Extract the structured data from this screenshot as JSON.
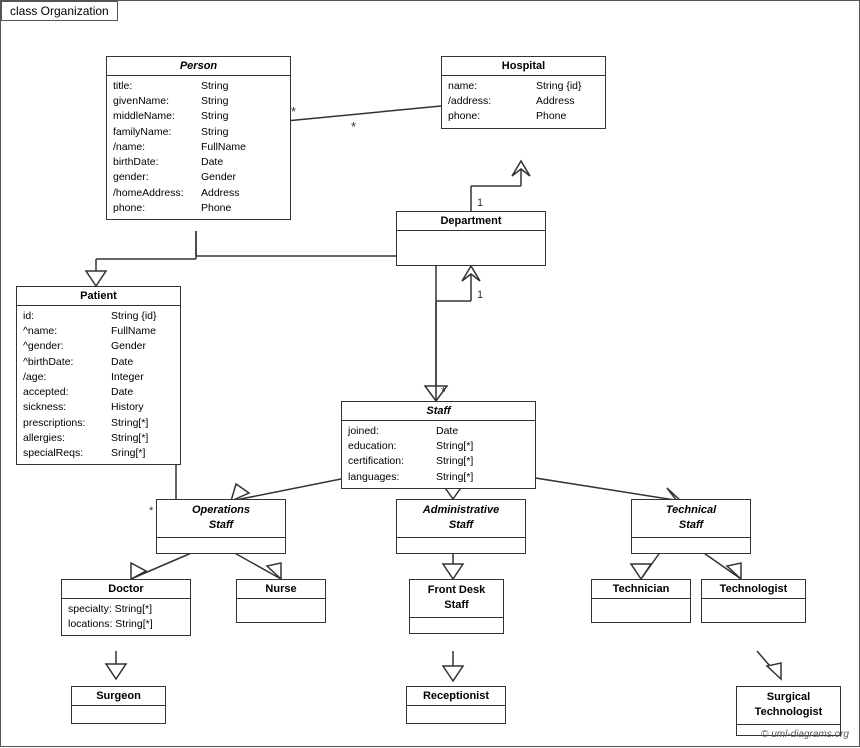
{
  "diagram": {
    "title": "class Organization",
    "classes": {
      "person": {
        "name": "Person",
        "italic": true,
        "attrs": [
          {
            "name": "title:",
            "type": "String"
          },
          {
            "name": "givenName:",
            "type": "String"
          },
          {
            "name": "middleName:",
            "type": "String"
          },
          {
            "name": "familyName:",
            "type": "String"
          },
          {
            "name": "/name:",
            "type": "FullName"
          },
          {
            "name": "birthDate:",
            "type": "Date"
          },
          {
            "name": "gender:",
            "type": "Gender"
          },
          {
            "name": "/homeAddress:",
            "type": "Address"
          },
          {
            "name": "phone:",
            "type": "Phone"
          }
        ]
      },
      "hospital": {
        "name": "Hospital",
        "italic": false,
        "attrs": [
          {
            "name": "name:",
            "type": "String {id}"
          },
          {
            "name": "/address:",
            "type": "Address"
          },
          {
            "name": "phone:",
            "type": "Phone"
          }
        ]
      },
      "patient": {
        "name": "Patient",
        "italic": false,
        "attrs": [
          {
            "name": "id:",
            "type": "String {id}"
          },
          {
            "name": "^name:",
            "type": "FullName"
          },
          {
            "name": "^gender:",
            "type": "Gender"
          },
          {
            "name": "^birthDate:",
            "type": "Date"
          },
          {
            "name": "/age:",
            "type": "Integer"
          },
          {
            "name": "accepted:",
            "type": "Date"
          },
          {
            "name": "sickness:",
            "type": "History"
          },
          {
            "name": "prescriptions:",
            "type": "String[*]"
          },
          {
            "name": "allergies:",
            "type": "String[*]"
          },
          {
            "name": "specialReqs:",
            "type": "Sring[*]"
          }
        ]
      },
      "department": {
        "name": "Department",
        "italic": false,
        "attrs": []
      },
      "staff": {
        "name": "Staff",
        "italic": true,
        "attrs": [
          {
            "name": "joined:",
            "type": "Date"
          },
          {
            "name": "education:",
            "type": "String[*]"
          },
          {
            "name": "certification:",
            "type": "String[*]"
          },
          {
            "name": "languages:",
            "type": "String[*]"
          }
        ]
      },
      "operations_staff": {
        "name": "Operations\nStaff",
        "italic": true,
        "attrs": []
      },
      "administrative_staff": {
        "name": "Administrative\nStaff",
        "italic": true,
        "attrs": []
      },
      "technical_staff": {
        "name": "Technical\nStaff",
        "italic": true,
        "attrs": []
      },
      "doctor": {
        "name": "Doctor",
        "italic": false,
        "attrs": [
          {
            "name": "specialty:",
            "type": "String[*]"
          },
          {
            "name": "locations:",
            "type": "String[*]"
          }
        ]
      },
      "nurse": {
        "name": "Nurse",
        "italic": false,
        "attrs": []
      },
      "front_desk_staff": {
        "name": "Front Desk\nStaff",
        "italic": false,
        "attrs": []
      },
      "technician": {
        "name": "Technician",
        "italic": false,
        "attrs": []
      },
      "technologist": {
        "name": "Technologist",
        "italic": false,
        "attrs": []
      },
      "surgeon": {
        "name": "Surgeon",
        "italic": false,
        "attrs": []
      },
      "receptionist": {
        "name": "Receptionist",
        "italic": false,
        "attrs": []
      },
      "surgical_technologist": {
        "name": "Surgical\nTechnologist",
        "italic": false,
        "attrs": []
      }
    },
    "copyright": "© uml-diagrams.org"
  }
}
